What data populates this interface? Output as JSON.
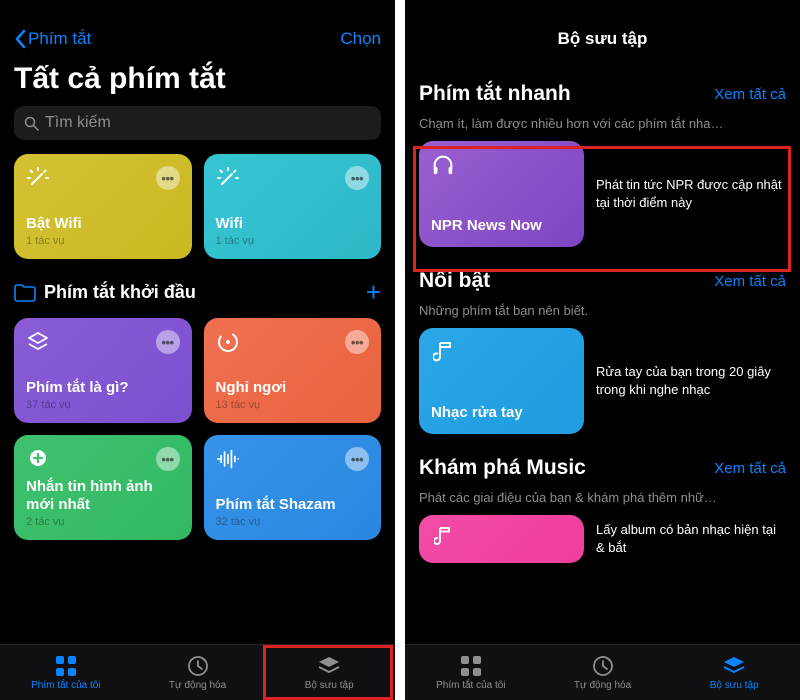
{
  "left": {
    "nav": {
      "back": "Phím tắt",
      "right": "Chọn"
    },
    "title": "Tất cả phím tắt",
    "search_placeholder": "Tìm kiếm",
    "cards": [
      {
        "title": "Bật Wifi",
        "sub": "1 tác vụ"
      },
      {
        "title": "Wifi",
        "sub": "1 tác vụ"
      }
    ],
    "section_header": "Phím tắt khởi đầu",
    "starter_cards": [
      {
        "title": "Phím tắt là gì?",
        "sub": "37 tác vụ"
      },
      {
        "title": "Nghỉ ngơi",
        "sub": "13 tác vụ"
      },
      {
        "title": "Nhắn tin hình ảnh mới nhất",
        "sub": "2 tác vụ"
      },
      {
        "title": "Phím tắt Shazam",
        "sub": "32 tác vụ"
      }
    ],
    "tabs": [
      {
        "label": "Phím tắt của tôi"
      },
      {
        "label": "Tự động hóa"
      },
      {
        "label": "Bộ sưu tập"
      }
    ]
  },
  "right": {
    "nav_title": "Bộ sưu tập",
    "sections": [
      {
        "title": "Phím tắt nhanh",
        "see_all": "Xem tất cả",
        "desc": "Chạm ít, làm được nhiều hơn với các phím tắt nha…",
        "card_title": "NPR News Now",
        "card_desc": "Phát tin tức NPR được cập nhật tại thời điểm này"
      },
      {
        "title": "Nổi bật",
        "see_all": "Xem tất cả",
        "desc": "Những phím tắt bạn nên biết.",
        "card_title": "Nhạc rửa tay",
        "card_desc": "Rửa tay của bạn trong 20 giây trong khi nghe nhạc"
      },
      {
        "title": "Khám phá Music",
        "see_all": "Xem tất cả",
        "desc": "Phát các giai điệu của bạn & khám phá thêm nhữ…",
        "card_desc": "Lấy album có bản nhạc hiện tại & bắt"
      }
    ],
    "tabs": [
      {
        "label": "Phím tắt của tôi"
      },
      {
        "label": "Tự động hóa"
      },
      {
        "label": "Bộ sưu tập"
      }
    ]
  }
}
